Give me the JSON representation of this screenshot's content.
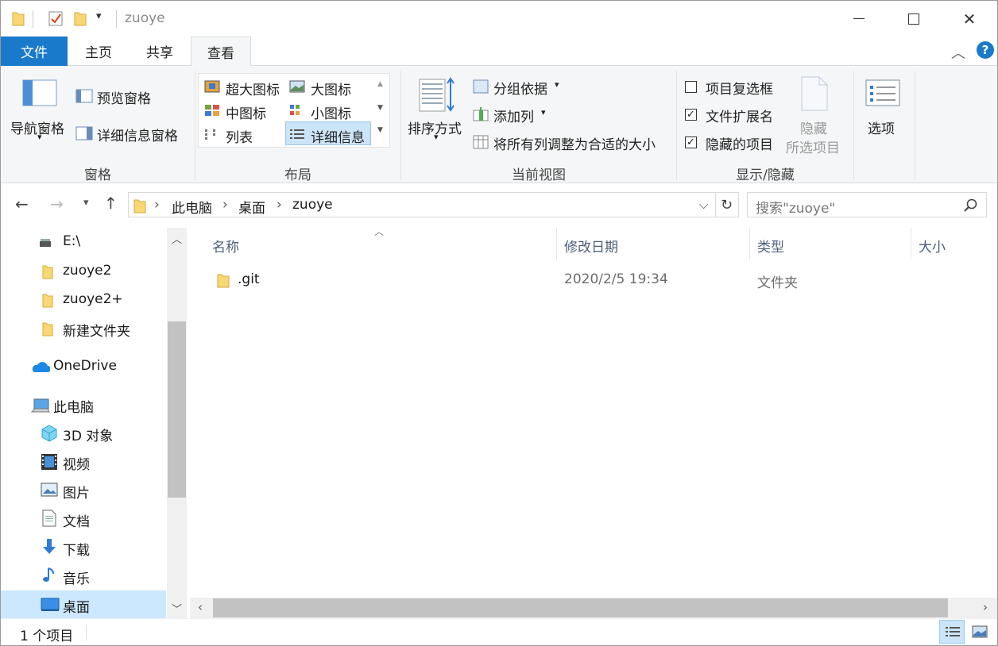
{
  "window": {
    "title": "zuoye"
  },
  "tabs": {
    "file": "文件",
    "home": "主页",
    "share": "共享",
    "view": "查看"
  },
  "ribbon": {
    "panes": {
      "nav_pane": "导航窗格",
      "preview_pane": "预览窗格",
      "details_pane": "详细信息窗格",
      "label": "窗格"
    },
    "layout": {
      "extra_large": "超大图标",
      "large": "大图标",
      "medium": "中图标",
      "small": "小图标",
      "list": "列表",
      "details": "详细信息",
      "label": "布局"
    },
    "current_view": {
      "sort_by": "排序方式",
      "group_by": "分组依据",
      "add_columns": "添加列",
      "size_all_columns": "将所有列调整为合适的大小",
      "label": "当前视图"
    },
    "show_hide": {
      "item_checkboxes": "项目复选框",
      "file_extensions": "文件扩展名",
      "hidden_items": "隐藏的项目",
      "hide_selected_1": "隐藏",
      "hide_selected_2": "所选项目",
      "label": "显示/隐藏",
      "item_checkboxes_checked": false,
      "file_extensions_checked": true,
      "hidden_items_checked": true
    },
    "options": {
      "label": "选项"
    }
  },
  "breadcrumb": [
    "此电脑",
    "桌面",
    "zuoye"
  ],
  "search": {
    "placeholder": "搜索\"zuoye\""
  },
  "nav": {
    "items": [
      {
        "label": "E:\\",
        "icon": "drive-icon"
      },
      {
        "label": "zuoye2",
        "icon": "folder-icon"
      },
      {
        "label": "zuoye2+",
        "icon": "folder-icon"
      },
      {
        "label": "新建文件夹",
        "icon": "folder-icon"
      },
      {
        "label": "OneDrive",
        "icon": "onedrive-icon"
      },
      {
        "label": "此电脑",
        "icon": "this-pc-icon"
      },
      {
        "label": "3D 对象",
        "icon": "3d-objects-icon"
      },
      {
        "label": "视频",
        "icon": "videos-icon"
      },
      {
        "label": "图片",
        "icon": "pictures-icon"
      },
      {
        "label": "文档",
        "icon": "documents-icon"
      },
      {
        "label": "下载",
        "icon": "downloads-icon"
      },
      {
        "label": "音乐",
        "icon": "music-icon"
      },
      {
        "label": "桌面",
        "icon": "desktop-icon"
      }
    ]
  },
  "columns": {
    "name": "名称",
    "modified": "修改日期",
    "type": "类型",
    "size": "大小"
  },
  "files": [
    {
      "name": ".git",
      "modified": "2020/2/5 19:34",
      "type": "文件夹",
      "size": ""
    }
  ],
  "status": {
    "count": "1 个项目"
  },
  "colors": {
    "accent": "#1979ca",
    "selection": "#cce8ff",
    "folder": "#f8d775"
  }
}
